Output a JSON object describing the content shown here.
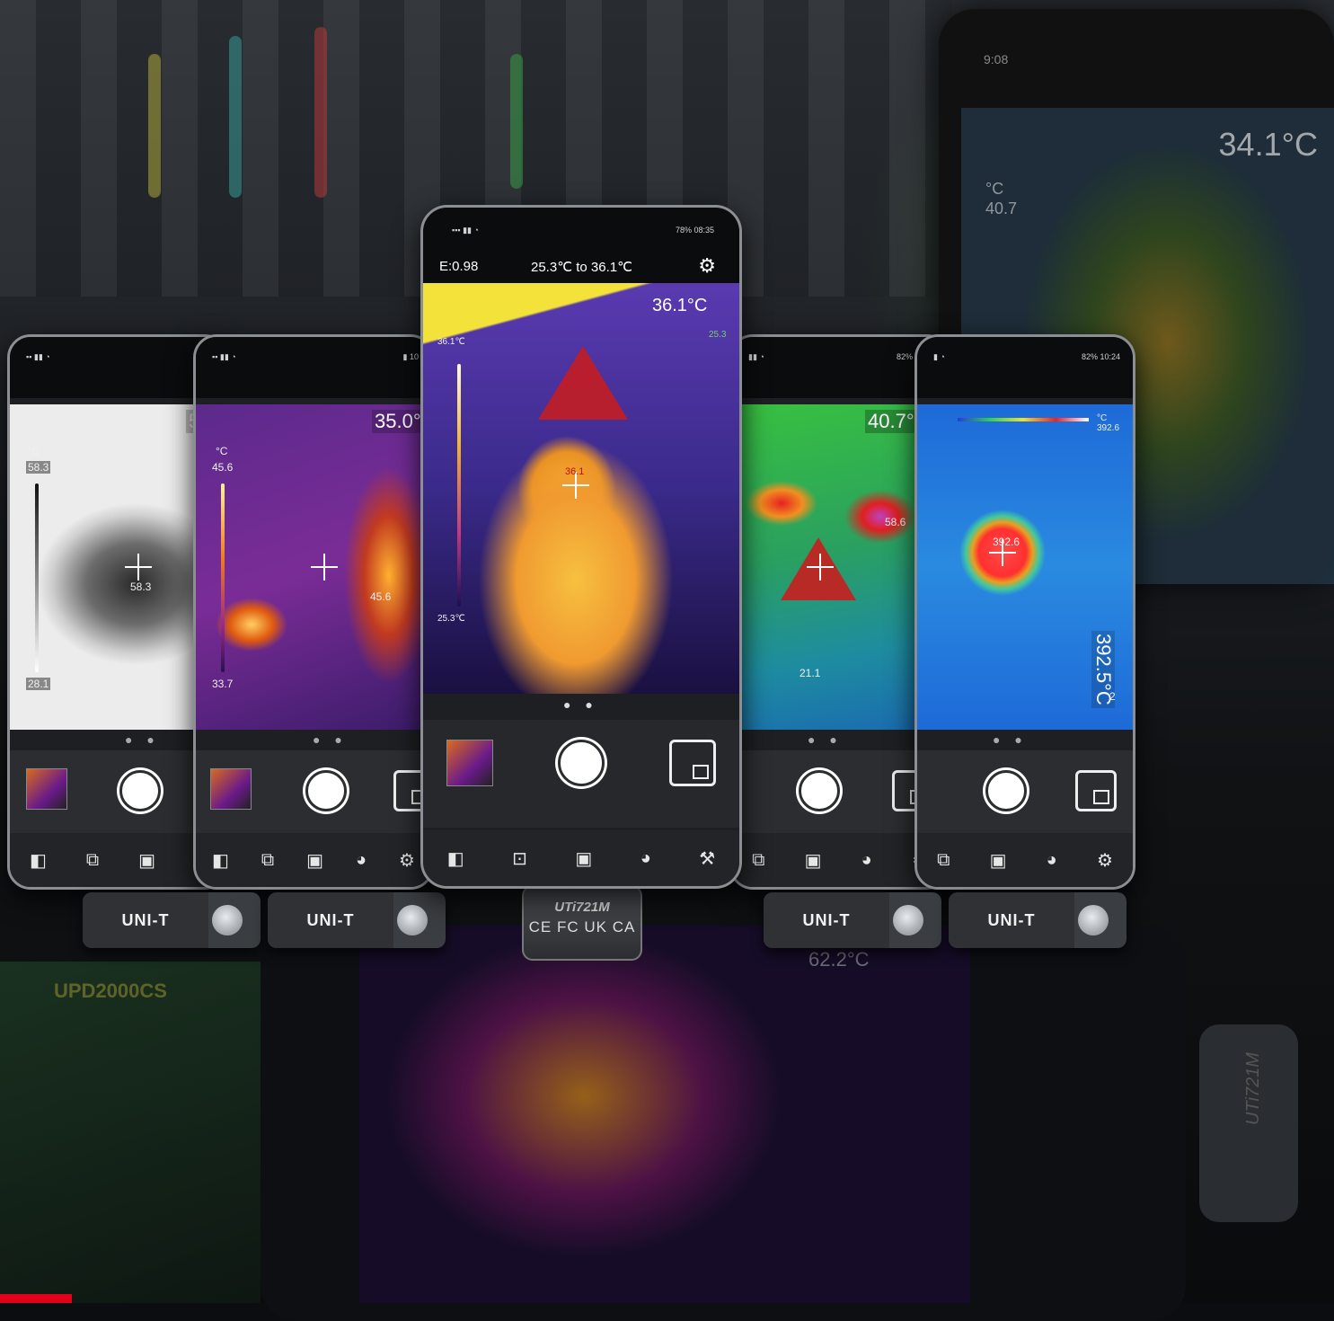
{
  "background": {
    "right_phone_time": "9:08",
    "right_phone_temp": "34.1°C",
    "right_phone_unit": "°C",
    "right_phone_max": "40.7",
    "bottom_phone_temp": "62.2°C",
    "bottom_pcb_text": "UPD2000CS",
    "bottom_cam_model": "UTi721M",
    "accent_color": "#e3001b"
  },
  "phones": [
    {
      "id": "grayscale",
      "max_label": "58.3",
      "min_label": "28.1",
      "unit": "°C",
      "spot_value": "58.3",
      "partial_label": "5"
    },
    {
      "id": "iron",
      "max_label": "45.6",
      "min_label": "33.7",
      "unit": "°C",
      "spot_value": "45.6",
      "big_value": "35.0°"
    },
    {
      "id": "center",
      "status_time": "78% 08:35",
      "emissivity": "E:0.98",
      "range": "25.3℃ to 36.1℃",
      "big_value": "36.1°C",
      "small_value": "25.3",
      "scale_max": "36.1℃",
      "scale_min": "25.3℃",
      "spot_value": "36.1"
    },
    {
      "id": "rainbow",
      "status_time": "82% 10:24",
      "big_value": "40.7°C",
      "spot_value": "58.6",
      "low_value": "21.1"
    },
    {
      "id": "hot-spot",
      "status_time": "82% 10:24",
      "scale_label": "392.6",
      "unit": "°C",
      "spot_value": "392.6",
      "big_value": "392.5°C",
      "low_value": "2"
    }
  ],
  "cameras": [
    {
      "brand": "UNI-T"
    },
    {
      "brand": "UNI-T"
    },
    {
      "brand": "UNI-T"
    },
    {
      "brand": "UNI-T"
    }
  ],
  "center_camera": {
    "model": "UTi721M",
    "certs": "CE FC UK CA"
  }
}
